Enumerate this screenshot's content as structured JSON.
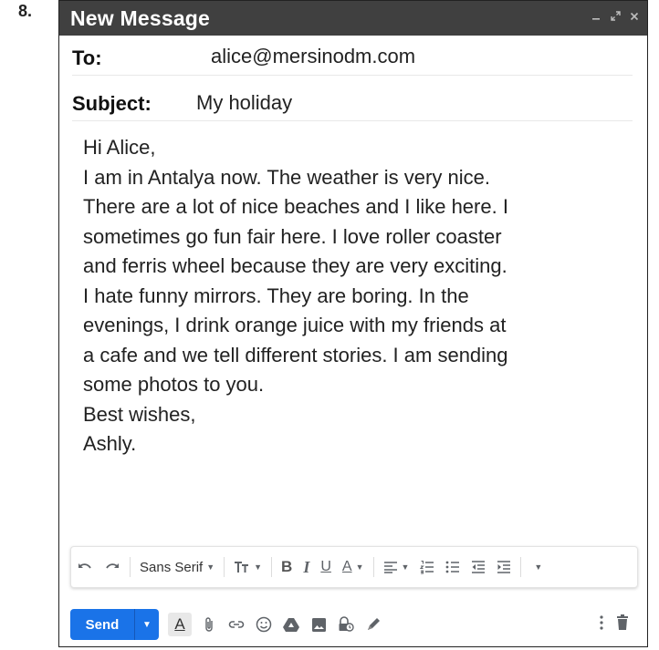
{
  "question_number": "8.",
  "window": {
    "title": "New Message",
    "controls": [
      "minimize-icon",
      "expand-icon",
      "close-icon"
    ]
  },
  "to": {
    "label": "To:",
    "value": "alice@mersinodm.com"
  },
  "subject": {
    "label": "Subject:",
    "value": "My holiday"
  },
  "body_lines": [
    "Hi Alice,",
    "I am in Antalya now. The weather is very nice.",
    "There are a lot of nice beaches and I like here. I",
    "sometimes go fun fair here. I love roller coaster",
    "and ferris wheel because they are very exciting.",
    "I hate funny mirrors. They are boring. In the",
    "evenings, I drink orange juice with my friends at",
    "a cafe and we tell different stories. I am sending",
    "some photos to you.",
    "Best wishes,",
    "Ashly."
  ],
  "formatting_toolbar": {
    "font": "Sans Serif",
    "bold": "B",
    "italic": "I",
    "underline": "U",
    "text_color": "A"
  },
  "bottom_toolbar": {
    "send_label": "Send",
    "formatting_toggle": "A"
  },
  "colors": {
    "title_bar": "#404040",
    "send_button": "#1a73e8"
  }
}
